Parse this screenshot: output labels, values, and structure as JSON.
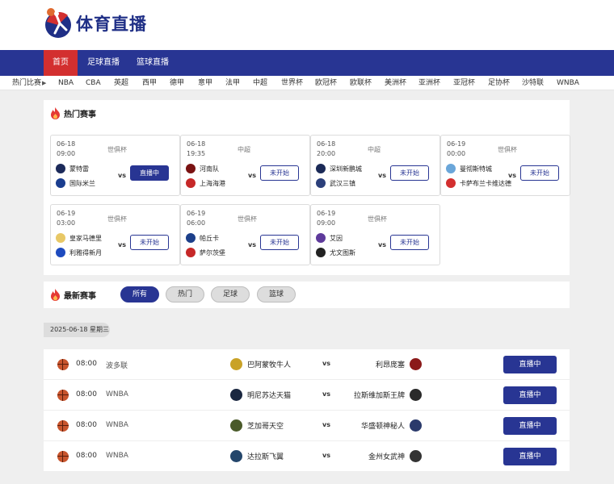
{
  "site": {
    "title": "体育直播"
  },
  "nav": {
    "items": [
      "首页",
      "足球直播",
      "篮球直播"
    ]
  },
  "subnav": {
    "label": "热门比赛",
    "items": [
      "NBA",
      "CBA",
      "英超",
      "西甲",
      "德甲",
      "意甲",
      "法甲",
      "中超",
      "世界杯",
      "欧冠杯",
      "欧联杯",
      "美洲杯",
      "亚洲杯",
      "亚冠杯",
      "足协杯",
      "沙特联",
      "WNBA"
    ]
  },
  "hot": {
    "title": "热门赛事",
    "cards": [
      {
        "date": "06-18",
        "time": "09:00",
        "league": "世俱杯",
        "home": "蒙特雷",
        "away": "国际米兰",
        "status": "直播中",
        "live": true,
        "home_color": "#1c2a5a",
        "away_color": "#1a3d8f"
      },
      {
        "date": "06-18",
        "time": "19:35",
        "league": "中超",
        "home": "河南队",
        "away": "上海海港",
        "status": "未开始",
        "live": false,
        "home_color": "#7a1212",
        "away_color": "#c62828"
      },
      {
        "date": "06-18",
        "time": "20:00",
        "league": "中超",
        "home": "深圳新鹏城",
        "away": "武汉三镇",
        "status": "未开始",
        "live": false,
        "home_color": "#1b2a57",
        "away_color": "#2b3f7a"
      },
      {
        "date": "06-19",
        "time": "00:00",
        "league": "世俱杯",
        "home": "曼彻斯特城",
        "away": "卡萨布兰卡维达德",
        "status": "未开始",
        "live": false,
        "home_color": "#6aa6d9",
        "away_color": "#d32f2f"
      },
      {
        "date": "06-19",
        "time": "03:00",
        "league": "世俱杯",
        "home": "皇家马德里",
        "away": "利雅得新月",
        "status": "未开始",
        "live": false,
        "home_color": "#e8c866",
        "away_color": "#1e4bbf"
      },
      {
        "date": "06-19",
        "time": "06:00",
        "league": "世俱杯",
        "home": "帕丘卡",
        "away": "萨尔茨堡",
        "status": "未开始",
        "live": false,
        "home_color": "#1c3f8a",
        "away_color": "#c62828"
      },
      {
        "date": "06-19",
        "time": "09:00",
        "league": "世俱杯",
        "home": "艾因",
        "away": "尤文图斯",
        "status": "未开始",
        "live": false,
        "home_color": "#5e3a9b",
        "away_color": "#222222"
      }
    ]
  },
  "latest": {
    "title": "最新赛事",
    "filters": [
      "所有",
      "热门",
      "足球",
      "篮球"
    ],
    "date_label": "2025-06-18 星期三",
    "matches": [
      {
        "time": "08:00",
        "league": "波多联",
        "home": "巴阿蒙牧牛人",
        "away": "利昂庞塞",
        "status": "直播中",
        "home_color": "#c9a227",
        "away_color": "#8b1a1a"
      },
      {
        "time": "08:00",
        "league": "WNBA",
        "home": "明尼苏达天猫",
        "away": "拉斯维加斯王牌",
        "status": "直播中",
        "home_color": "#1a2740",
        "away_color": "#2a2a2a"
      },
      {
        "time": "08:00",
        "league": "WNBA",
        "home": "芝加哥天空",
        "away": "华盛顿神秘人",
        "status": "直播中",
        "home_color": "#4a5a2a",
        "away_color": "#2b3a6b"
      },
      {
        "time": "08:00",
        "league": "WNBA",
        "home": "达拉斯飞翼",
        "away": "金州女武神",
        "status": "直播中",
        "home_color": "#24466b",
        "away_color": "#333333"
      }
    ]
  }
}
